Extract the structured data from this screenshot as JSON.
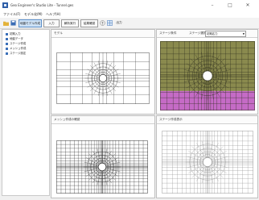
{
  "window": {
    "title": "Geo Engineer's Studio Lite - Tunnel.ges",
    "minimize": "–",
    "maximize": "□",
    "close": "✕"
  },
  "menu": [
    "ファイル(F)",
    "モデル化(M)",
    "ヘルプ(H)"
  ],
  "toolbar": {
    "buttons": [
      "地盤モデル作成",
      "入力",
      "解析実行",
      "結果確認",
      "出力"
    ],
    "icons": [
      "folder-icon",
      "save-icon",
      "help-icon",
      "grid-icon"
    ]
  },
  "tree": {
    "items": [
      "初期入力",
      "地盤データ",
      "ステージ作成",
      "メッシュ作成",
      "ステージ設定"
    ]
  },
  "panes": {
    "model": {
      "title": "モデル"
    },
    "stage": {
      "title": "ステージ条件",
      "stage_label": "ステージ選択",
      "stage_value": "初期応力"
    },
    "mesh": {
      "title": "メッシュ作成の確認"
    },
    "stage_result": {
      "title": "ステージ作成表示"
    }
  },
  "colors": {
    "olive": "#8a8a4e",
    "magenta": "#c56bc6",
    "grid": "#555555",
    "accent": "#cfe3f7"
  }
}
